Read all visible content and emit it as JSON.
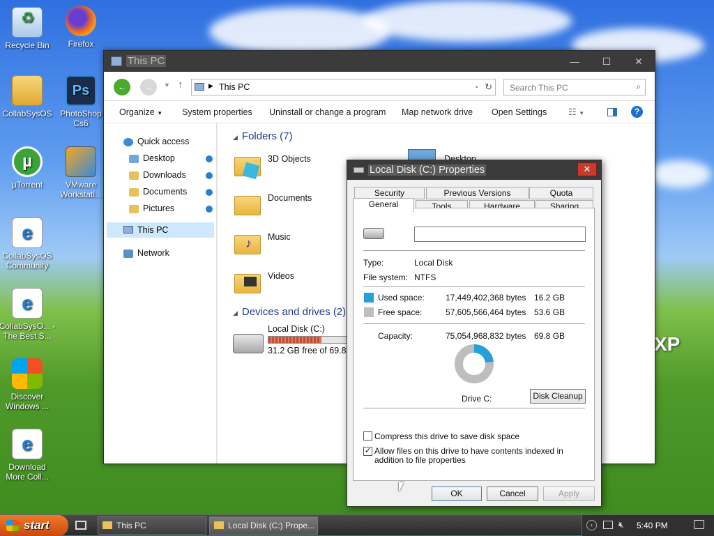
{
  "desktop": {
    "icons": [
      {
        "label": "Recycle Bin"
      },
      {
        "label": "Firefox"
      },
      {
        "label": "CollabSysOS"
      },
      {
        "label": "PhotoShop Cs6"
      },
      {
        "label": "µTorrent"
      },
      {
        "label": "VMware Workstati..."
      },
      {
        "label": "CollabSysOS Community"
      },
      {
        "label": "CollabSysO... - The Best S..."
      },
      {
        "label": "Discover Windows ..."
      },
      {
        "label": "Download More Coll..."
      }
    ],
    "wallpaper_text": "XP"
  },
  "explorer": {
    "title": "This PC",
    "address": "This PC",
    "search_placeholder": "Search This PC",
    "commands": [
      "Organize",
      "System properties",
      "Uninstall or change a program",
      "Map network drive",
      "Open Settings"
    ],
    "nav": {
      "quick_access": "Quick access",
      "items": [
        "Desktop",
        "Downloads",
        "Documents",
        "Pictures"
      ],
      "this_pc": "This PC",
      "network": "Network"
    },
    "folders_header": "Folders (7)",
    "folders": [
      "3D Objects",
      "Documents",
      "Music",
      "Videos"
    ],
    "folder_partial": "Desktop",
    "devices_header": "Devices and drives (2)",
    "drive": {
      "name": "Local Disk (C:)",
      "free_text": "31.2 GB free of 69.8 G",
      "used_fraction": 0.553
    }
  },
  "dialog": {
    "title": "Local Disk (C:) Properties",
    "tabs_top": [
      "Security",
      "Previous Versions",
      "Quota"
    ],
    "tabs_bottom": [
      "General",
      "Tools",
      "Hardware",
      "Sharing"
    ],
    "name_value": "",
    "type_label": "Type:",
    "type_value": "Local Disk",
    "fs_label": "File system:",
    "fs_value": "NTFS",
    "used_label": "Used space:",
    "used_bytes": "17,449,402,368 bytes",
    "used_gb": "16.2 GB",
    "free_label": "Free space:",
    "free_bytes": "57,605,566,464 bytes",
    "free_gb": "53.6 GB",
    "capacity_label": "Capacity:",
    "capacity_bytes": "75,054,968,832 bytes",
    "capacity_gb": "69.8 GB",
    "drive_label": "Drive C:",
    "disk_cleanup": "Disk Cleanup",
    "compress_label": "Compress this drive to save disk space",
    "compress_checked": false,
    "index_label": "Allow files on this drive to have contents indexed in addition to file properties",
    "index_checked": true,
    "ok": "OK",
    "cancel": "Cancel",
    "apply": "Apply",
    "colors": {
      "used": "#26a0da",
      "free": "#bebebe"
    },
    "used_fraction": 0.2325
  },
  "taskbar": {
    "start": "start",
    "tasks": [
      "This PC",
      "Local Disk (C:) Prope..."
    ],
    "clock": "5:40 PM"
  }
}
